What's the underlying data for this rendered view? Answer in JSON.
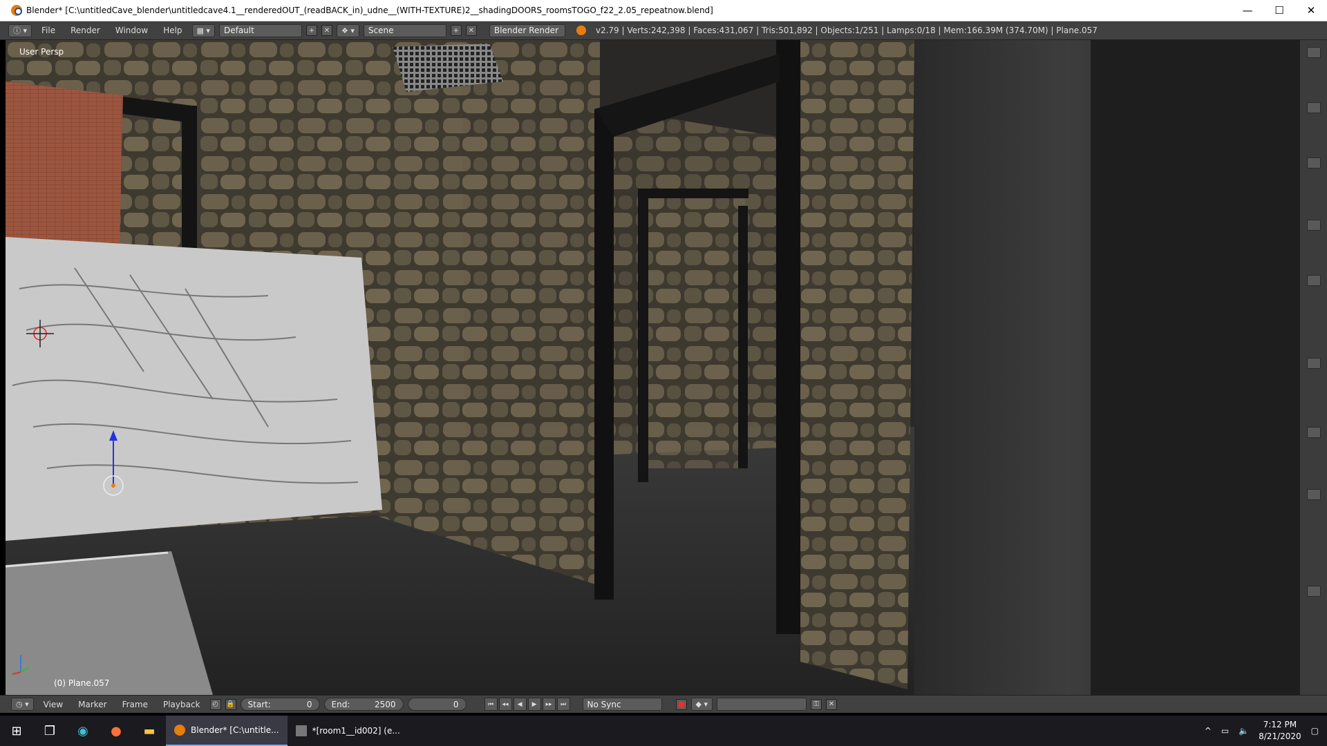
{
  "window": {
    "title": "Blender* [C:\\untitledCave_blender\\untitledcave4.1__renderedOUT_(readBACK_in)_udne__(WITH-TEXTURE)2__shadingDOORS_roomsTOGO_f22_2.05_repeatnow.blend]",
    "minimize": "—",
    "maximize": "☐",
    "close": "✕"
  },
  "infobar": {
    "menus": [
      "File",
      "Render",
      "Window",
      "Help"
    ],
    "screen_layout": "Default",
    "scene": "Scene",
    "render_engine": "Blender Render",
    "stats": "v2.79 | Verts:242,398 | Faces:431,067 | Tris:501,892 | Objects:1/251 | Lamps:0/18 | Mem:166.39M (374.70M) | Plane.057"
  },
  "viewport": {
    "view_label": "User Persp",
    "object_label": "(0) Plane.057"
  },
  "timeline": {
    "menus": [
      "View",
      "Marker",
      "Frame",
      "Playback"
    ],
    "start_label": "Start:",
    "start_value": "0",
    "end_label": "End:",
    "end_value": "2500",
    "current_frame": "0",
    "sync": "No Sync"
  },
  "taskbar": {
    "apps": [
      {
        "label": "Blender* [C:\\untitle..."
      },
      {
        "label": "*[room1__id002] (e..."
      }
    ],
    "time": "7:12 PM",
    "date": "8/21/2020"
  },
  "colors": {
    "ui_dark": "#414141",
    "stone": "#5e5646",
    "floor": "#2b2b2b",
    "accent_orange": "#e87d0d"
  }
}
